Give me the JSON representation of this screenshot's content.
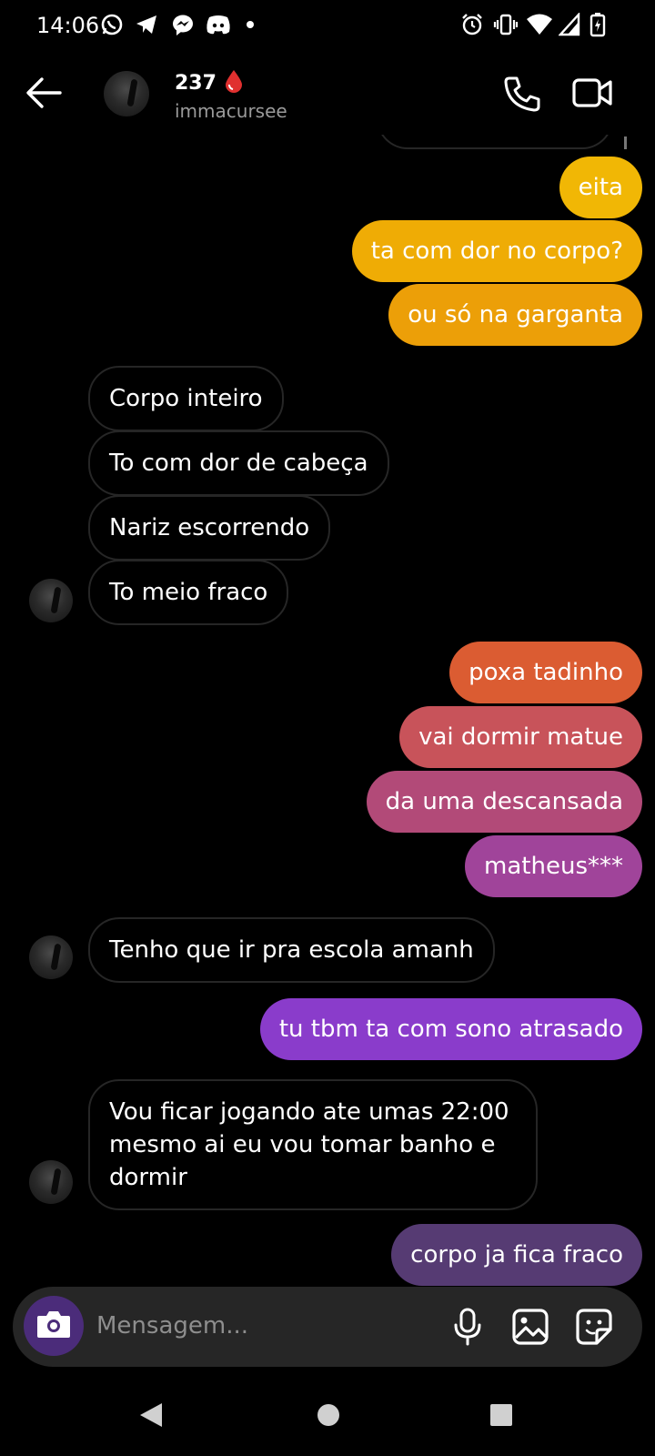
{
  "status_bar": {
    "time": "14:06",
    "left_icons": [
      "whatsapp-icon",
      "telegram-icon",
      "messenger-icon",
      "discord-icon",
      "dot-icon"
    ],
    "right_icons": [
      "alarm-icon",
      "vibrate-icon",
      "wifi-icon",
      "signal-icon",
      "battery-charging-icon"
    ]
  },
  "header": {
    "back_icon": "arrow-left-icon",
    "display_name": "237",
    "name_emoji": "🩸",
    "username": "immacursee",
    "call_icon": "phone-icon",
    "video_icon": "video-camera-icon"
  },
  "messages": [
    {
      "side": "out",
      "text": "eita"
    },
    {
      "side": "out",
      "text": "ta com dor no corpo?"
    },
    {
      "side": "out",
      "text": "ou só na garganta"
    },
    {
      "side": "in",
      "text": "Corpo inteiro"
    },
    {
      "side": "in",
      "text": "To com dor de cabeça"
    },
    {
      "side": "in",
      "text": "Nariz escorrendo"
    },
    {
      "side": "in",
      "text": "To meio fraco"
    },
    {
      "side": "out",
      "text": "poxa tadinho"
    },
    {
      "side": "out",
      "text": "vai dormir matue"
    },
    {
      "side": "out",
      "text": "da uma descansada"
    },
    {
      "side": "out",
      "text": "matheus***"
    },
    {
      "side": "in",
      "text": "Tenho que ir pra escola amanh"
    },
    {
      "side": "out",
      "text": "tu tbm ta com sono atrasado"
    },
    {
      "side": "in",
      "text": "Vou ficar jogando ate umas 22:00 mesmo ai eu vou tomar banho e dormir"
    },
    {
      "side": "out",
      "text": "corpo ja fica fraco"
    }
  ],
  "composer": {
    "placeholder": "Mensagem...",
    "camera_icon": "camera-icon",
    "mic_icon": "microphone-icon",
    "gallery_icon": "image-icon",
    "sticker_icon": "sticker-icon"
  },
  "nav_bar": {
    "back": "triangle-back-icon",
    "home": "circle-home-icon",
    "recents": "square-recents-icon"
  },
  "colors": {
    "background": "#000000",
    "incoming_border": "#262626",
    "composer_bg": "#262626",
    "gradient_top": "#F2B705",
    "gradient_mid": "#D9492C",
    "gradient_purple": "#8A3CCB",
    "gradient_bottom": "#563B73"
  }
}
